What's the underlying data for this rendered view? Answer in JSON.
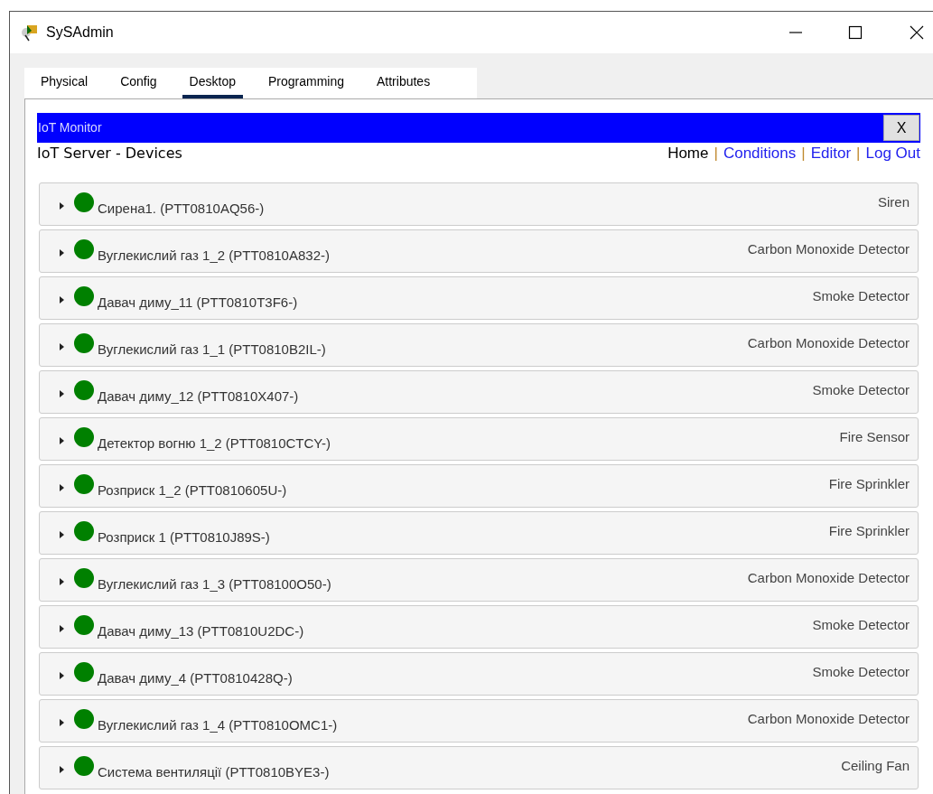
{
  "window": {
    "title": "SySAdmin"
  },
  "tabs": [
    {
      "label": "Physical",
      "selected": false
    },
    {
      "label": "Config",
      "selected": false
    },
    {
      "label": "Desktop",
      "selected": true
    },
    {
      "label": "Programming",
      "selected": false
    },
    {
      "label": "Attributes",
      "selected": false
    }
  ],
  "app": {
    "title": "IoT Monitor",
    "close_label": "X",
    "heading": "IoT Server - Devices"
  },
  "nav": [
    {
      "label": "Home",
      "selected": true
    },
    {
      "label": "Conditions",
      "selected": false
    },
    {
      "label": "Editor",
      "selected": false
    },
    {
      "label": "Log Out",
      "selected": false
    }
  ],
  "nav_separator": "|",
  "devices": [
    {
      "name": "Сирена1. (PTT0810AQ56-)",
      "type": "Siren",
      "color": "#008000",
      "expanded": false
    },
    {
      "name": "Вуглекислий газ 1_2 (PTT0810A832-)",
      "type": "Carbon Monoxide Detector",
      "color": "#008000",
      "expanded": false
    },
    {
      "name": "Давач диму_11 (PTT0810T3F6-)",
      "type": "Smoke Detector",
      "color": "#008000",
      "expanded": false
    },
    {
      "name": "Вуглекислий газ 1_1 (PTT0810B2IL-)",
      "type": "Carbon Monoxide Detector",
      "color": "#008000",
      "expanded": false
    },
    {
      "name": "Давач диму_12 (PTT0810X407-)",
      "type": "Smoke Detector",
      "color": "#008000",
      "expanded": false
    },
    {
      "name": "Детектор вогню 1_2 (PTT0810CTCY-)",
      "type": "Fire Sensor",
      "color": "#008000",
      "expanded": false
    },
    {
      "name": "Розприск 1_2 (PTT0810605U-)",
      "type": "Fire Sprinkler",
      "color": "#008000",
      "expanded": false
    },
    {
      "name": "Розприск 1 (PTT0810J89S-)",
      "type": "Fire Sprinkler",
      "color": "#008000",
      "expanded": false
    },
    {
      "name": "Вуглекислий газ 1_3 (PTT08100O50-)",
      "type": "Carbon Monoxide Detector",
      "color": "#008000",
      "expanded": false
    },
    {
      "name": "Давач диму_13 (PTT0810U2DC-)",
      "type": "Smoke Detector",
      "color": "#008000",
      "expanded": false
    },
    {
      "name": "Давач диму_4 (PTT0810428Q-)",
      "type": "Smoke Detector",
      "color": "#008000",
      "expanded": false
    },
    {
      "name": "Вуглекислий газ 1_4 (PTT0810OMC1-)",
      "type": "Carbon Monoxide Detector",
      "color": "#008000",
      "expanded": false
    },
    {
      "name": "Система вентиляції (PTT0810BYE3-)",
      "type": "Ceiling Fan",
      "color": "#008000",
      "expanded": false
    }
  ]
}
